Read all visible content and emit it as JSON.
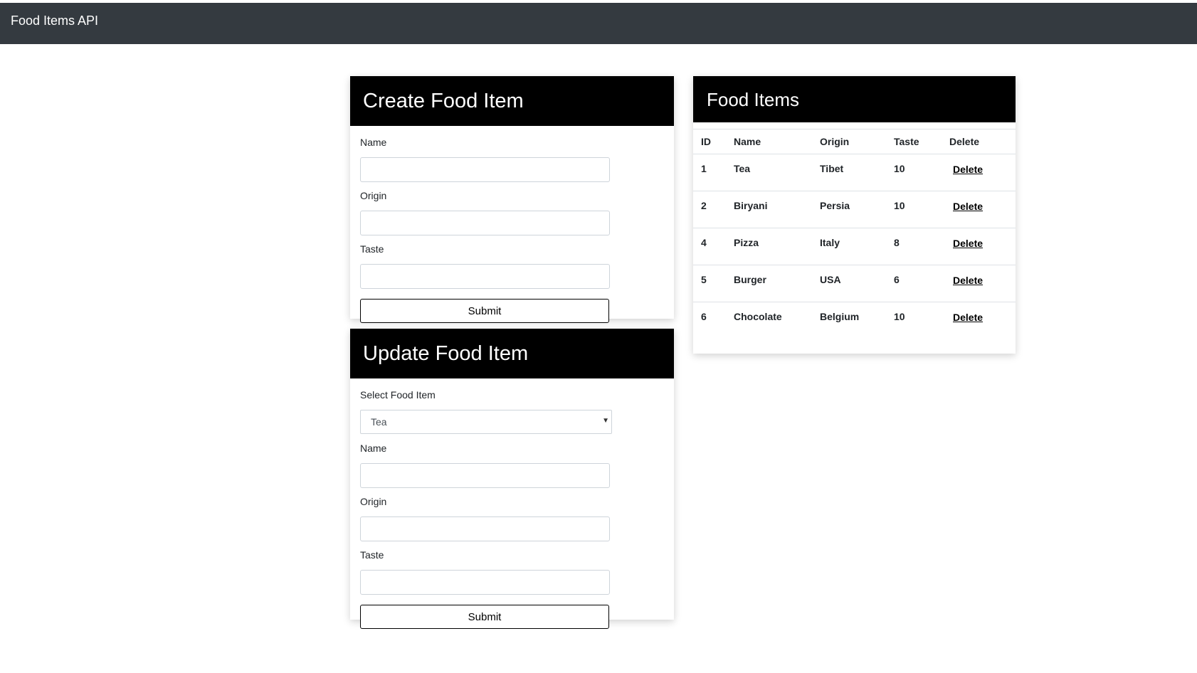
{
  "navbar": {
    "brand": "Food Items API"
  },
  "create_form": {
    "title": "Create Food Item",
    "name_label": "Name",
    "origin_label": "Origin",
    "taste_label": "Taste",
    "name_value": "",
    "origin_value": "",
    "taste_value": "",
    "submit_label": "Submit"
  },
  "update_form": {
    "title": "Update Food Item",
    "select_label": "Select Food Item",
    "select_value": "Tea",
    "name_label": "Name",
    "origin_label": "Origin",
    "taste_label": "Taste",
    "name_value": "",
    "origin_value": "",
    "taste_value": "",
    "submit_label": "Submit"
  },
  "items_table": {
    "title": "Food Items",
    "columns": [
      "ID",
      "Name",
      "Origin",
      "Taste",
      "Delete"
    ],
    "rows": [
      {
        "id": "1",
        "name": "Tea",
        "origin": "Tibet",
        "taste": "10",
        "delete_label": "Delete"
      },
      {
        "id": "2",
        "name": "Biryani",
        "origin": "Persia",
        "taste": "10",
        "delete_label": "Delete"
      },
      {
        "id": "4",
        "name": "Pizza",
        "origin": "Italy",
        "taste": "8",
        "delete_label": "Delete"
      },
      {
        "id": "5",
        "name": "Burger",
        "origin": "USA",
        "taste": "6",
        "delete_label": "Delete"
      },
      {
        "id": "6",
        "name": "Chocolate",
        "origin": "Belgium",
        "taste": "10",
        "delete_label": "Delete"
      }
    ]
  },
  "colors": {
    "navbar_bg": "#343a40",
    "card_header_bg": "#000000",
    "card_header_text": "#ffffff"
  }
}
